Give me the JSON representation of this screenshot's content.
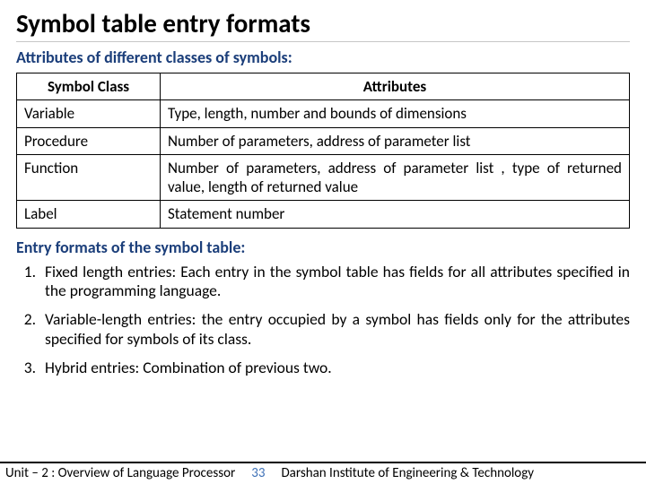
{
  "title": "Symbol table entry formats",
  "section1_title": "Attributes of different classes of symbols:",
  "table": {
    "headers": [
      "Symbol Class",
      "Attributes"
    ],
    "rows": [
      {
        "c0": "Variable",
        "c1": "Type, length, number and bounds of dimensions"
      },
      {
        "c0": "Procedure",
        "c1": "Number of parameters, address of parameter list"
      },
      {
        "c0": "Function",
        "c1": "Number of parameters, address of parameter list , type of returned value, length of returned value"
      },
      {
        "c0": "Label",
        "c1": "Statement number"
      }
    ]
  },
  "section2_title": "Entry formats of the symbol table:",
  "formats": [
    "Fixed length entries: Each entry in the symbol table has fields for all attributes specified in the programming language.",
    "Variable-length entries: the entry occupied by a symbol has fields only for the attributes specified for symbols of its class.",
    "Hybrid entries: Combination of previous two."
  ],
  "footer": {
    "left": "Unit – 2  : Overview of Language Processor",
    "page": "33",
    "right": "Darshan Institute of Engineering & Technology"
  }
}
